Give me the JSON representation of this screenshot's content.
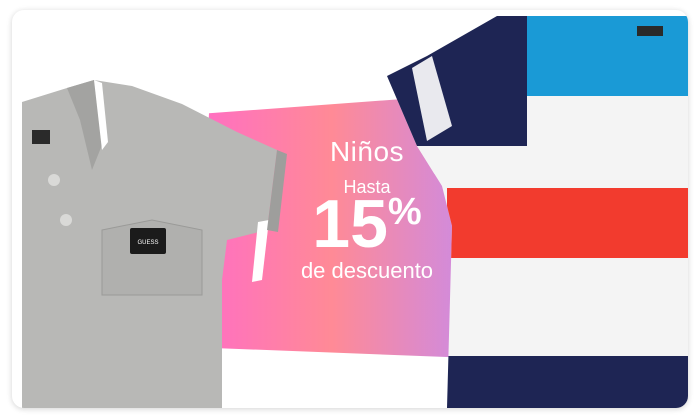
{
  "promo": {
    "category": "Niños",
    "prefix": "Hasta",
    "value": "15",
    "unit": "%",
    "suffix": "de descuento"
  },
  "products": [
    {
      "name": "polo-shirt",
      "brand_tag": "GUESS"
    },
    {
      "name": "striped-tshirt"
    }
  ],
  "colors": {
    "gradient_start": "#ff6ec4",
    "gradient_end": "#c38bf2",
    "polo": "#b8b8b6",
    "stripe_navy": "#1e2554",
    "stripe_blue": "#1a9ad6",
    "stripe_red": "#f23b2e"
  }
}
